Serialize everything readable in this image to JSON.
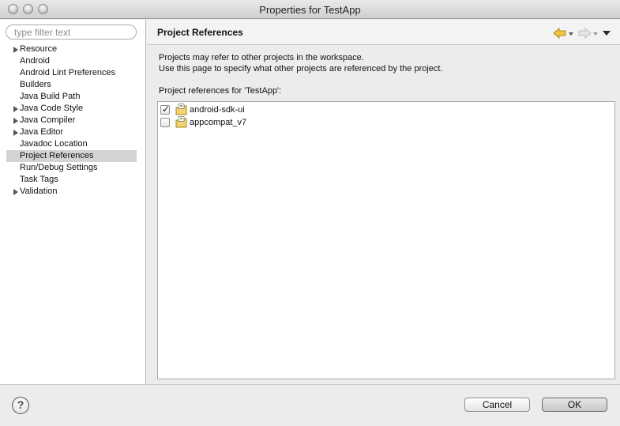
{
  "window": {
    "title": "Properties for TestApp"
  },
  "filter": {
    "placeholder": "type filter text"
  },
  "tree": {
    "items": [
      {
        "label": "Resource",
        "expandable": true
      },
      {
        "label": "Android",
        "expandable": false
      },
      {
        "label": "Android Lint Preferences",
        "expandable": false
      },
      {
        "label": "Builders",
        "expandable": false
      },
      {
        "label": "Java Build Path",
        "expandable": false
      },
      {
        "label": "Java Code Style",
        "expandable": true
      },
      {
        "label": "Java Compiler",
        "expandable": true
      },
      {
        "label": "Java Editor",
        "expandable": true
      },
      {
        "label": "Javadoc Location",
        "expandable": false
      },
      {
        "label": "Project References",
        "expandable": false,
        "selected": true
      },
      {
        "label": "Run/Debug Settings",
        "expandable": false
      },
      {
        "label": "Task Tags",
        "expandable": false
      },
      {
        "label": "Validation",
        "expandable": true
      }
    ]
  },
  "page": {
    "title": "Project References",
    "description_line1": "Projects may refer to other projects in the workspace.",
    "description_line2": "Use this page to specify what other projects are referenced by the project.",
    "refs_label": "Project references for 'TestApp':",
    "references": [
      {
        "name": "android-sdk-ui",
        "checked": true
      },
      {
        "name": "appcompat_v7",
        "checked": false
      }
    ]
  },
  "nav": {
    "back_icon": "back-arrow-icon",
    "forward_icon": "forward-arrow-icon",
    "menu_icon": "view-menu-icon"
  },
  "buttons": {
    "help_glyph": "?",
    "cancel": "Cancel",
    "ok": "OK"
  },
  "colors": {
    "selection": "#d4d4d4",
    "back_arrow": "#f0c040"
  }
}
